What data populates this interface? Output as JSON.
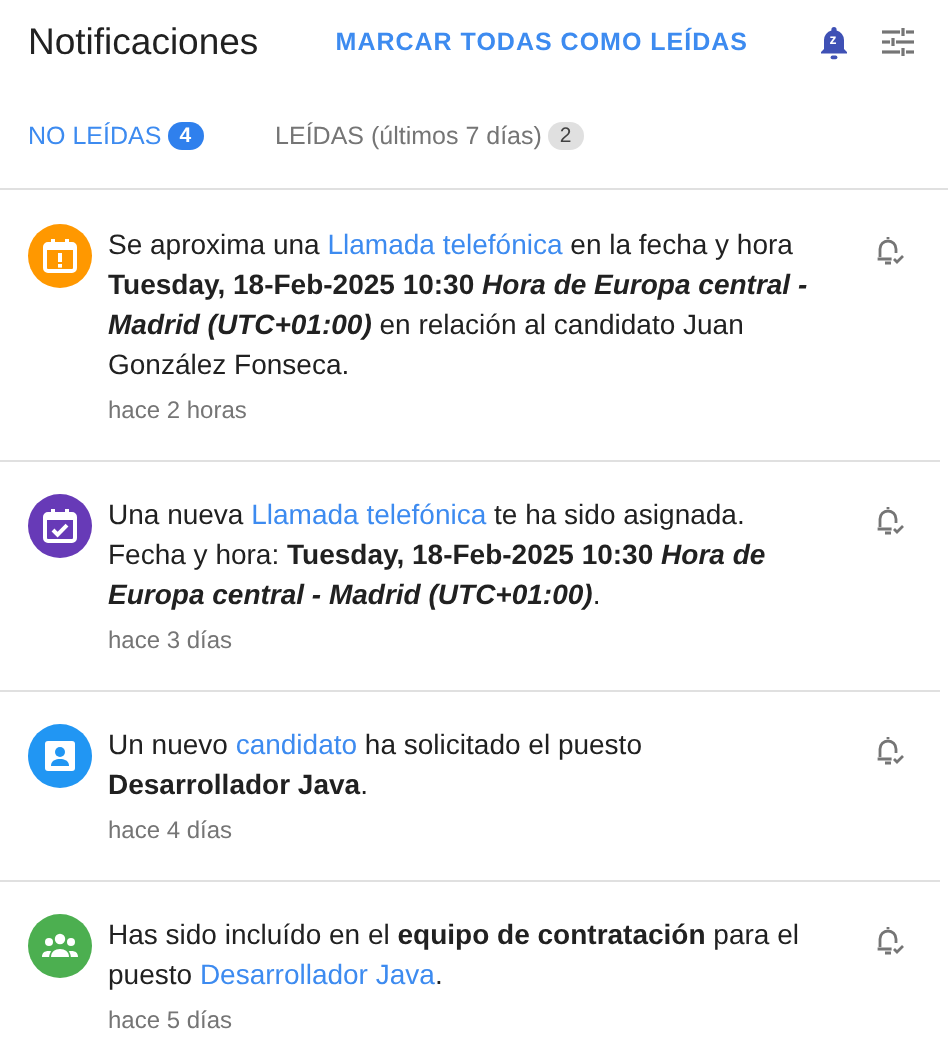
{
  "header": {
    "title": "Notificaciones",
    "mark_all": "MARCAR TODAS COMO LEÍDAS",
    "snooze_badge": "z"
  },
  "tabs": [
    {
      "label": "NO LEÍDAS",
      "count": "4",
      "selected": true
    },
    {
      "label": "LEÍDAS (últimos 7 días)",
      "count": "2",
      "selected": false
    }
  ],
  "notifications": [
    {
      "kind": "calendar-alert",
      "color": "#ff9800",
      "time": "hace 2 horas",
      "message": [
        {
          "kind": "plain",
          "text": "Se aproxima una "
        },
        {
          "kind": "link",
          "text": "Llamada telefónica"
        },
        {
          "kind": "plain",
          "text": " en la fecha y hora "
        },
        {
          "kind": "bold",
          "text": "Tuesday, 18-Feb-2025 10:30 "
        },
        {
          "kind": "bolditalic",
          "text": "Hora de Europa central - Madrid (UTC+01:00)"
        },
        {
          "kind": "plain",
          "text": " en relación al candidato Juan González Fonseca."
        }
      ]
    },
    {
      "kind": "calendar-check",
      "color": "#673ab7",
      "time": "hace 3 días",
      "message": [
        {
          "kind": "plain",
          "text": "Una nueva "
        },
        {
          "kind": "link",
          "text": "Llamada telefónica"
        },
        {
          "kind": "plain",
          "text": " te ha sido asignada. Fecha y hora: "
        },
        {
          "kind": "bold",
          "text": "Tuesday, 18-Feb-2025 10:30 "
        },
        {
          "kind": "bolditalic",
          "text": "Hora de Europa central - Madrid (UTC+01:00)"
        },
        {
          "kind": "plain",
          "text": "."
        }
      ]
    },
    {
      "kind": "person-card",
      "color": "#2196f3",
      "time": "hace 4 días",
      "message": [
        {
          "kind": "plain",
          "text": "Un nuevo "
        },
        {
          "kind": "link",
          "text": "candidato"
        },
        {
          "kind": "plain",
          "text": " ha solicitado el puesto "
        },
        {
          "kind": "bold",
          "text": "Desarrollador Java"
        },
        {
          "kind": "plain",
          "text": "."
        }
      ]
    },
    {
      "kind": "group",
      "color": "#4caf50",
      "time": "hace 5 días",
      "message": [
        {
          "kind": "plain",
          "text": "Has sido incluído en el "
        },
        {
          "kind": "bold",
          "text": "equipo de contratación"
        },
        {
          "kind": "plain",
          "text": " para el puesto "
        },
        {
          "kind": "link",
          "text": "Desarrollador Java"
        },
        {
          "kind": "plain",
          "text": "."
        }
      ]
    }
  ]
}
